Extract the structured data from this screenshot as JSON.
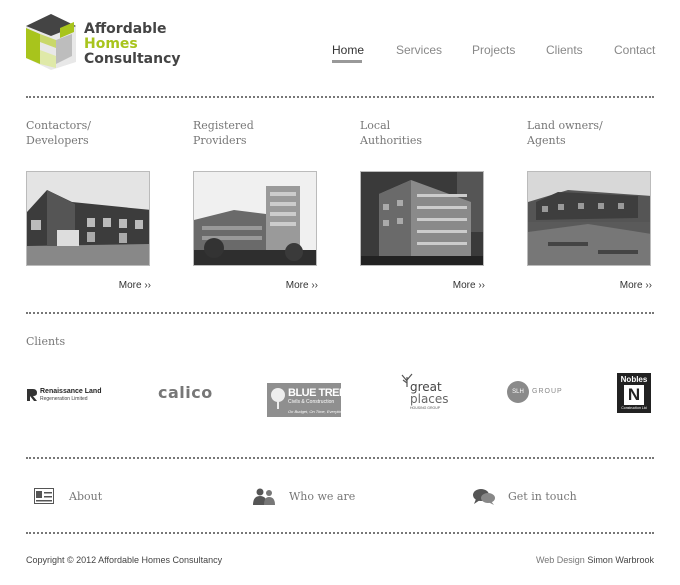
{
  "logo": {
    "line1": "Affordable",
    "line2": "Homes",
    "line3": "Consultancy",
    "accent": "#a8c41c"
  },
  "nav": [
    "Home",
    "Services",
    "Projects",
    "Clients",
    "Contact"
  ],
  "categories": [
    {
      "line1": "Contactors/",
      "line2": "Developers",
      "more": "More ››"
    },
    {
      "line1": "Registered",
      "line2": "Providers",
      "more": "More ››"
    },
    {
      "line1": "Local",
      "line2": "Authorities",
      "more": "More ››"
    },
    {
      "line1": "Land owners/",
      "line2": "Agents",
      "more": "More ››"
    }
  ],
  "clients": {
    "label": "Clients",
    "logos": {
      "renaissance_name": "Renaissance Land",
      "renaissance_sub": "Regeneration Limited",
      "calico": "calico",
      "bluetree_name": "BLUE TREE",
      "bluetree_sub": "Civils & Construction",
      "bluetree_tag": "On Budget, On Time, Everytime",
      "greatplaces_1": "great",
      "greatplaces_2": "places",
      "greatplaces_3": "HOUSING GROUP",
      "slh_mark": "SLH",
      "slh_word": "GROUP",
      "nobles_name": "Nobles",
      "nobles_letter": "N",
      "nobles_sub": "Construction Ltd"
    }
  },
  "footer_links": [
    "About",
    "Who we are",
    "Get in touch"
  ],
  "copyright": "Copyright © 2012 Affordable Homes Consultancy",
  "credit_prefix": "Web Design",
  "credit_name": "Simon Warbrook"
}
